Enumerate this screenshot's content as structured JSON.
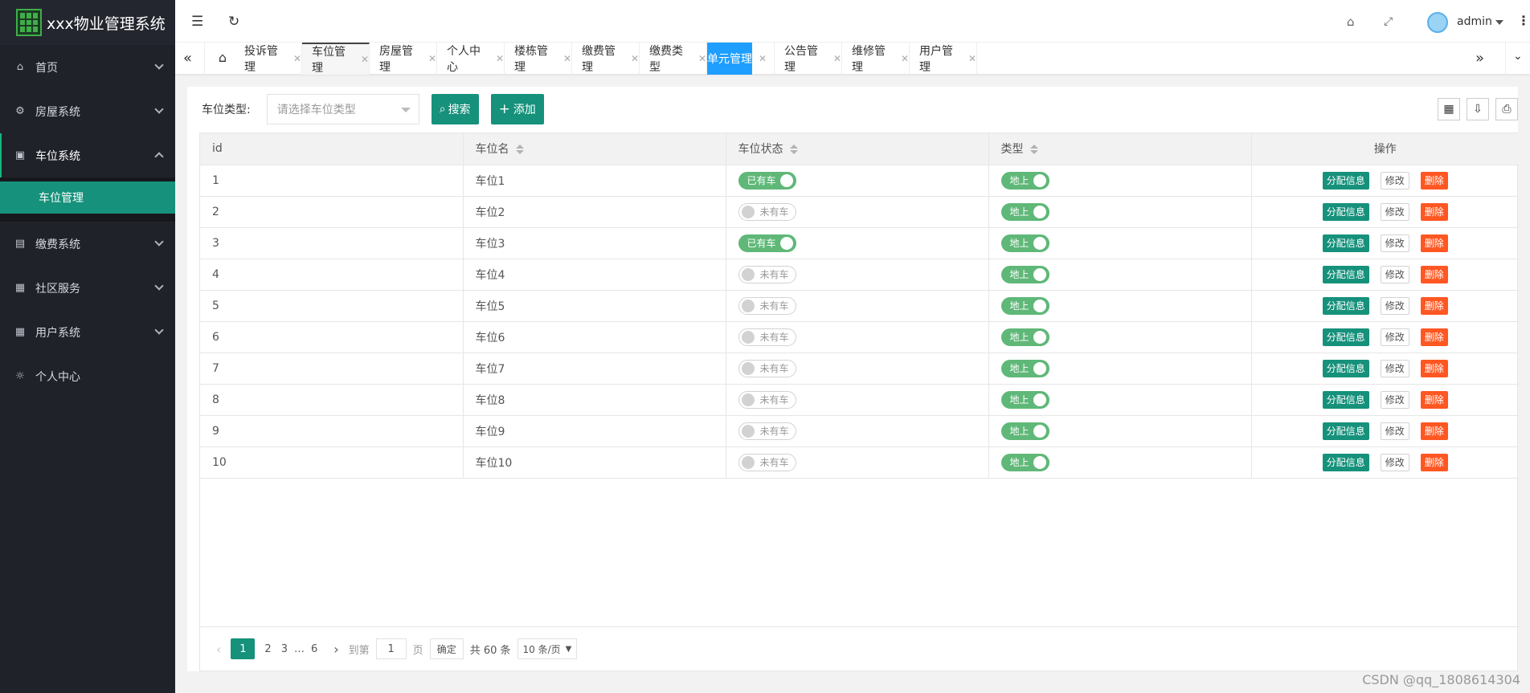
{
  "app": {
    "title": "xxx物业管理系统"
  },
  "sidebar": {
    "items": [
      {
        "label": "首页",
        "icon": "home-icon",
        "expanded": false
      },
      {
        "label": "房屋系统",
        "icon": "gear-icon",
        "expanded": false
      },
      {
        "label": "车位系统",
        "icon": "box-icon",
        "expanded": true,
        "children": [
          {
            "label": "车位管理"
          }
        ]
      },
      {
        "label": "缴费系统",
        "icon": "ledger-icon",
        "expanded": false
      },
      {
        "label": "社区服务",
        "icon": "apps-icon",
        "expanded": false
      },
      {
        "label": "用户系统",
        "icon": "apps-icon",
        "expanded": false
      },
      {
        "label": "个人中心",
        "icon": "settings-icon",
        "expanded": false
      }
    ]
  },
  "header": {
    "user": "admin"
  },
  "tabs": [
    {
      "label": "投诉管理"
    },
    {
      "label": "车位管理",
      "active": true
    },
    {
      "label": "房屋管理"
    },
    {
      "label": "个人中心"
    },
    {
      "label": "楼栋管理"
    },
    {
      "label": "缴费管理"
    },
    {
      "label": "缴费类型"
    },
    {
      "label": "单元管理",
      "highlight": true
    },
    {
      "label": "公告管理"
    },
    {
      "label": "维修管理"
    },
    {
      "label": "用户管理"
    }
  ],
  "filter": {
    "label": "车位类型:",
    "placeholder": "请选择车位类型",
    "search": "搜索",
    "add": "添加"
  },
  "table": {
    "columns": [
      "id",
      "车位名",
      "车位状态",
      "类型",
      "操作"
    ],
    "rows": [
      {
        "id": "1",
        "name": "车位1",
        "status": "已有车",
        "status_on": true,
        "type": "地上"
      },
      {
        "id": "2",
        "name": "车位2",
        "status": "未有车",
        "status_on": false,
        "type": "地上"
      },
      {
        "id": "3",
        "name": "车位3",
        "status": "已有车",
        "status_on": true,
        "type": "地上"
      },
      {
        "id": "4",
        "name": "车位4",
        "status": "未有车",
        "status_on": false,
        "type": "地上"
      },
      {
        "id": "5",
        "name": "车位5",
        "status": "未有车",
        "status_on": false,
        "type": "地上"
      },
      {
        "id": "6",
        "name": "车位6",
        "status": "未有车",
        "status_on": false,
        "type": "地上"
      },
      {
        "id": "7",
        "name": "车位7",
        "status": "未有车",
        "status_on": false,
        "type": "地上"
      },
      {
        "id": "8",
        "name": "车位8",
        "status": "未有车",
        "status_on": false,
        "type": "地上"
      },
      {
        "id": "9",
        "name": "车位9",
        "status": "未有车",
        "status_on": false,
        "type": "地上"
      },
      {
        "id": "10",
        "name": "车位10",
        "status": "未有车",
        "status_on": false,
        "type": "地上"
      }
    ],
    "actions": {
      "assign": "分配信息",
      "edit": "修改",
      "delete": "删除"
    }
  },
  "pager": {
    "pages": [
      "1",
      "2",
      "3",
      "…",
      "6"
    ],
    "current": "1",
    "goto_label": "到第",
    "goto_value": "1",
    "page_unit": "页",
    "confirm": "确定",
    "total": "共 60 条",
    "page_size": "10 条/页"
  },
  "watermark": "CSDN @qq_1808614304"
}
